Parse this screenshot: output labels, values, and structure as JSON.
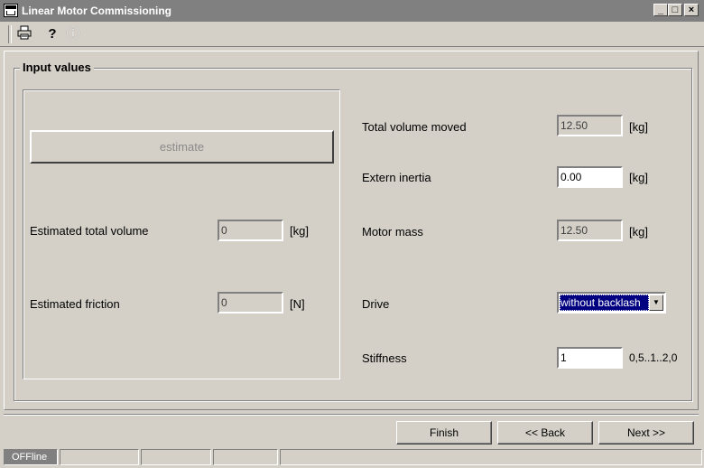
{
  "window": {
    "title": "Linear Motor Commissioning",
    "minimize_glyph": "_",
    "maximize_glyph": "□",
    "close_glyph": "×"
  },
  "toolbar": {
    "icons": [
      "printer-icon",
      "help-icon",
      "info-icon"
    ],
    "help_glyph": "?",
    "info_glyph": "ⓘ"
  },
  "group": {
    "title": "Input values"
  },
  "left_panel": {
    "estimate_label": "estimate",
    "estimated_total_volume": {
      "label": "Estimated total volume",
      "value": "0",
      "unit": "[kg]"
    },
    "estimated_friction": {
      "label": "Estimated friction",
      "value": "0",
      "unit": "[N]"
    }
  },
  "right_panel": {
    "total_volume_moved": {
      "label": "Total volume moved",
      "value": "12.50",
      "unit": "[kg]"
    },
    "extern_inertia": {
      "label": "Extern inertia",
      "value": "0.00",
      "unit": "[kg]"
    },
    "motor_mass": {
      "label": "Motor mass",
      "value": "12.50",
      "unit": "[kg]"
    },
    "drive": {
      "label": "Drive",
      "selected": "without backlash"
    },
    "stiffness": {
      "label": "Stiffness",
      "value": "1",
      "range": "0,5..1..2,0"
    }
  },
  "buttons": {
    "finish": "Finish",
    "back": "<< Back",
    "next": "Next >>"
  },
  "status": {
    "mode": "OFFline"
  },
  "colors": {
    "face": "#d4d0c8",
    "titlebar_inactive": "#808080",
    "selection": "#000080"
  }
}
